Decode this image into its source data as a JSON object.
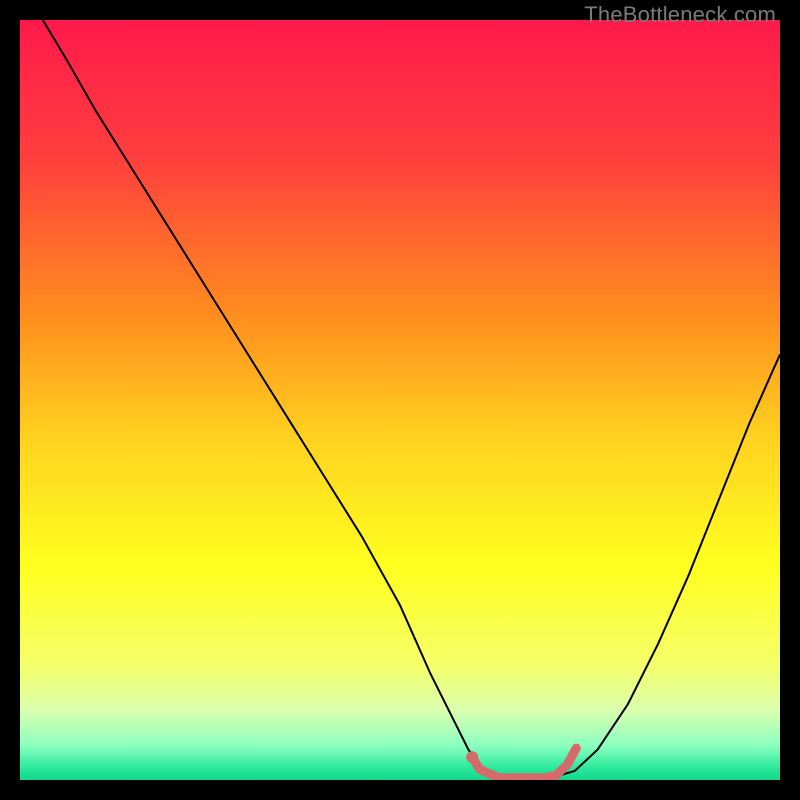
{
  "watermark": "TheBottleneck.com",
  "chart_data": {
    "type": "line",
    "title": "",
    "xlabel": "",
    "ylabel": "",
    "xlim": [
      0,
      100
    ],
    "ylim": [
      0,
      100
    ],
    "grid": false,
    "background_gradient": {
      "stops": [
        {
          "offset": 0.0,
          "color": "#ff1a4b"
        },
        {
          "offset": 0.18,
          "color": "#ff3e3e"
        },
        {
          "offset": 0.38,
          "color": "#ff8a1f"
        },
        {
          "offset": 0.55,
          "color": "#ffd21f"
        },
        {
          "offset": 0.72,
          "color": "#ffff1f"
        },
        {
          "offset": 0.85,
          "color": "#f5ff6a"
        },
        {
          "offset": 0.91,
          "color": "#d8ffb0"
        },
        {
          "offset": 0.955,
          "color": "#8affc0"
        },
        {
          "offset": 0.985,
          "color": "#28e89a"
        },
        {
          "offset": 1.0,
          "color": "#14d68c"
        }
      ]
    },
    "series": [
      {
        "name": "curve",
        "color": "#000000",
        "width": 2,
        "x": [
          3,
          6,
          10,
          15,
          20,
          25,
          30,
          35,
          40,
          45,
          50,
          54,
          57,
          59,
          61,
          65,
          70,
          73,
          76,
          80,
          84,
          88,
          92,
          96,
          100
        ],
        "y": [
          100,
          95,
          88,
          80,
          72,
          64,
          56,
          48,
          40,
          32,
          23,
          14,
          8,
          4,
          1.2,
          0.3,
          0.3,
          1.2,
          4,
          10,
          18,
          27,
          37,
          47,
          56
        ]
      },
      {
        "name": "optimal-zone",
        "color": "#d66a6a",
        "width": 9,
        "x": [
          59.5,
          60.5,
          63,
          66,
          69,
          70.5,
          72,
          73.2
        ],
        "y": [
          3.0,
          1.4,
          0.3,
          0.3,
          0.3,
          0.6,
          2.0,
          4.2
        ]
      }
    ],
    "markers": [
      {
        "name": "optimal-start-dot",
        "x": 59.5,
        "y": 3.0,
        "r": 6,
        "color": "#d66a6a"
      }
    ]
  }
}
